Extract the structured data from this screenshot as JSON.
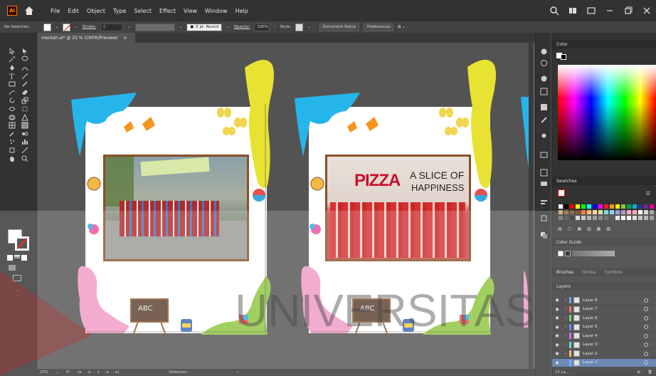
{
  "app": {
    "logo_text": "Ai",
    "menu": [
      "File",
      "Edit",
      "Object",
      "Type",
      "Select",
      "Effect",
      "View",
      "Window",
      "Help"
    ]
  },
  "control": {
    "selection": "No Selection",
    "stroke_label": "Stroke:",
    "brush": "5 pt. Round",
    "opacity_label": "Opacity:",
    "opacity_value": "100%",
    "style_label": "Style:",
    "doc_setup": "Document Setup",
    "preferences": "Preferences"
  },
  "document": {
    "tab_title": "mentah.ai* @ 25 % (CMYK/Preview)",
    "close": "×"
  },
  "panels": {
    "color": "Color",
    "swatches": "Swatches",
    "color_guide": "Color Guide",
    "brushes": "Brushes",
    "stroke": "Stroke",
    "symbols": "Symbols",
    "layers": "Layers"
  },
  "layers": [
    {
      "name": "Layer 8",
      "color": "#4f8bff"
    },
    {
      "name": "Layer 7",
      "color": "#ff4f4f"
    },
    {
      "name": "Layer 6",
      "color": "#4fd14f"
    },
    {
      "name": "Layer 5",
      "color": "#4f6bff"
    },
    {
      "name": "Layer 4",
      "color": "#c44fff"
    },
    {
      "name": "Layer 3",
      "color": "#4fd1c4"
    },
    {
      "name": "Layer 2",
      "color": "#ffb04f"
    },
    {
      "name": "Layer 1",
      "color": "#4fa0ff"
    }
  ],
  "layers_footer": "15 La...",
  "artwork": {
    "board_letters": "ABC",
    "pizza_word": "PIZZA",
    "pizza_slogan_1": "A SLICE OF",
    "pizza_slogan_2": "HAPPINESS"
  },
  "status": {
    "zoom": "25%",
    "rotation": "0°",
    "artboard": "1",
    "tool": "Selection"
  },
  "watermark": "UNIVERSITAS"
}
